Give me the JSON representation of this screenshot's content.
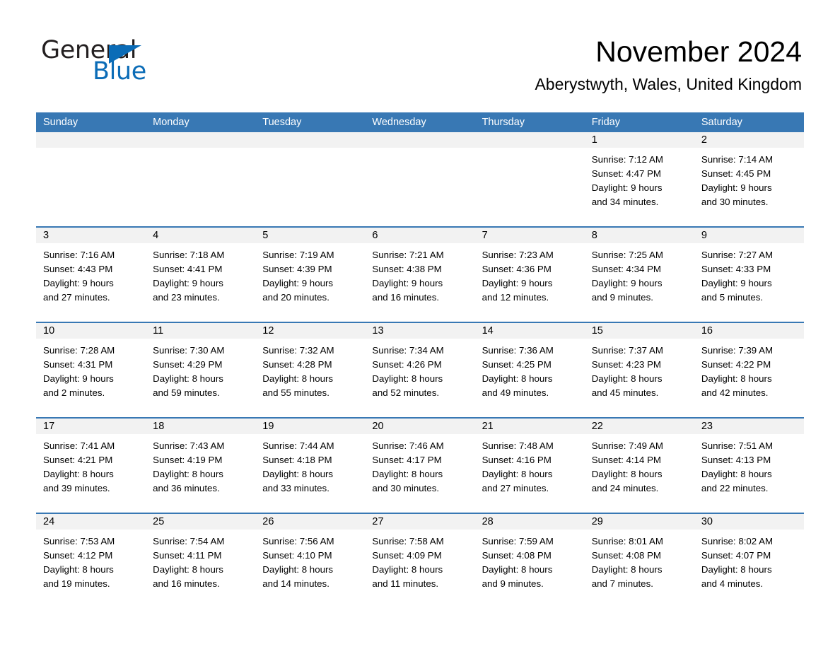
{
  "logo": {
    "word_one": "General",
    "word_two": "Blue",
    "triangle_color": "#0b6cb7"
  },
  "header": {
    "month_title": "November 2024",
    "location": "Aberystwyth, Wales, United Kingdom"
  },
  "colors": {
    "header_band": "#3878b4",
    "daynum_band": "#f2f2f2",
    "text": "#000000"
  },
  "weekday_headers": [
    "Sunday",
    "Monday",
    "Tuesday",
    "Wednesday",
    "Thursday",
    "Friday",
    "Saturday"
  ],
  "weeks": [
    [
      {
        "day": "",
        "sunrise": "",
        "sunset": "",
        "daylight_line1": "",
        "daylight_line2": ""
      },
      {
        "day": "",
        "sunrise": "",
        "sunset": "",
        "daylight_line1": "",
        "daylight_line2": ""
      },
      {
        "day": "",
        "sunrise": "",
        "sunset": "",
        "daylight_line1": "",
        "daylight_line2": ""
      },
      {
        "day": "",
        "sunrise": "",
        "sunset": "",
        "daylight_line1": "",
        "daylight_line2": ""
      },
      {
        "day": "",
        "sunrise": "",
        "sunset": "",
        "daylight_line1": "",
        "daylight_line2": ""
      },
      {
        "day": "1",
        "sunrise": "Sunrise: 7:12 AM",
        "sunset": "Sunset: 4:47 PM",
        "daylight_line1": "Daylight: 9 hours",
        "daylight_line2": "and 34 minutes."
      },
      {
        "day": "2",
        "sunrise": "Sunrise: 7:14 AM",
        "sunset": "Sunset: 4:45 PM",
        "daylight_line1": "Daylight: 9 hours",
        "daylight_line2": "and 30 minutes."
      }
    ],
    [
      {
        "day": "3",
        "sunrise": "Sunrise: 7:16 AM",
        "sunset": "Sunset: 4:43 PM",
        "daylight_line1": "Daylight: 9 hours",
        "daylight_line2": "and 27 minutes."
      },
      {
        "day": "4",
        "sunrise": "Sunrise: 7:18 AM",
        "sunset": "Sunset: 4:41 PM",
        "daylight_line1": "Daylight: 9 hours",
        "daylight_line2": "and 23 minutes."
      },
      {
        "day": "5",
        "sunrise": "Sunrise: 7:19 AM",
        "sunset": "Sunset: 4:39 PM",
        "daylight_line1": "Daylight: 9 hours",
        "daylight_line2": "and 20 minutes."
      },
      {
        "day": "6",
        "sunrise": "Sunrise: 7:21 AM",
        "sunset": "Sunset: 4:38 PM",
        "daylight_line1": "Daylight: 9 hours",
        "daylight_line2": "and 16 minutes."
      },
      {
        "day": "7",
        "sunrise": "Sunrise: 7:23 AM",
        "sunset": "Sunset: 4:36 PM",
        "daylight_line1": "Daylight: 9 hours",
        "daylight_line2": "and 12 minutes."
      },
      {
        "day": "8",
        "sunrise": "Sunrise: 7:25 AM",
        "sunset": "Sunset: 4:34 PM",
        "daylight_line1": "Daylight: 9 hours",
        "daylight_line2": "and 9 minutes."
      },
      {
        "day": "9",
        "sunrise": "Sunrise: 7:27 AM",
        "sunset": "Sunset: 4:33 PM",
        "daylight_line1": "Daylight: 9 hours",
        "daylight_line2": "and 5 minutes."
      }
    ],
    [
      {
        "day": "10",
        "sunrise": "Sunrise: 7:28 AM",
        "sunset": "Sunset: 4:31 PM",
        "daylight_line1": "Daylight: 9 hours",
        "daylight_line2": "and 2 minutes."
      },
      {
        "day": "11",
        "sunrise": "Sunrise: 7:30 AM",
        "sunset": "Sunset: 4:29 PM",
        "daylight_line1": "Daylight: 8 hours",
        "daylight_line2": "and 59 minutes."
      },
      {
        "day": "12",
        "sunrise": "Sunrise: 7:32 AM",
        "sunset": "Sunset: 4:28 PM",
        "daylight_line1": "Daylight: 8 hours",
        "daylight_line2": "and 55 minutes."
      },
      {
        "day": "13",
        "sunrise": "Sunrise: 7:34 AM",
        "sunset": "Sunset: 4:26 PM",
        "daylight_line1": "Daylight: 8 hours",
        "daylight_line2": "and 52 minutes."
      },
      {
        "day": "14",
        "sunrise": "Sunrise: 7:36 AM",
        "sunset": "Sunset: 4:25 PM",
        "daylight_line1": "Daylight: 8 hours",
        "daylight_line2": "and 49 minutes."
      },
      {
        "day": "15",
        "sunrise": "Sunrise: 7:37 AM",
        "sunset": "Sunset: 4:23 PM",
        "daylight_line1": "Daylight: 8 hours",
        "daylight_line2": "and 45 minutes."
      },
      {
        "day": "16",
        "sunrise": "Sunrise: 7:39 AM",
        "sunset": "Sunset: 4:22 PM",
        "daylight_line1": "Daylight: 8 hours",
        "daylight_line2": "and 42 minutes."
      }
    ],
    [
      {
        "day": "17",
        "sunrise": "Sunrise: 7:41 AM",
        "sunset": "Sunset: 4:21 PM",
        "daylight_line1": "Daylight: 8 hours",
        "daylight_line2": "and 39 minutes."
      },
      {
        "day": "18",
        "sunrise": "Sunrise: 7:43 AM",
        "sunset": "Sunset: 4:19 PM",
        "daylight_line1": "Daylight: 8 hours",
        "daylight_line2": "and 36 minutes."
      },
      {
        "day": "19",
        "sunrise": "Sunrise: 7:44 AM",
        "sunset": "Sunset: 4:18 PM",
        "daylight_line1": "Daylight: 8 hours",
        "daylight_line2": "and 33 minutes."
      },
      {
        "day": "20",
        "sunrise": "Sunrise: 7:46 AM",
        "sunset": "Sunset: 4:17 PM",
        "daylight_line1": "Daylight: 8 hours",
        "daylight_line2": "and 30 minutes."
      },
      {
        "day": "21",
        "sunrise": "Sunrise: 7:48 AM",
        "sunset": "Sunset: 4:16 PM",
        "daylight_line1": "Daylight: 8 hours",
        "daylight_line2": "and 27 minutes."
      },
      {
        "day": "22",
        "sunrise": "Sunrise: 7:49 AM",
        "sunset": "Sunset: 4:14 PM",
        "daylight_line1": "Daylight: 8 hours",
        "daylight_line2": "and 24 minutes."
      },
      {
        "day": "23",
        "sunrise": "Sunrise: 7:51 AM",
        "sunset": "Sunset: 4:13 PM",
        "daylight_line1": "Daylight: 8 hours",
        "daylight_line2": "and 22 minutes."
      }
    ],
    [
      {
        "day": "24",
        "sunrise": "Sunrise: 7:53 AM",
        "sunset": "Sunset: 4:12 PM",
        "daylight_line1": "Daylight: 8 hours",
        "daylight_line2": "and 19 minutes."
      },
      {
        "day": "25",
        "sunrise": "Sunrise: 7:54 AM",
        "sunset": "Sunset: 4:11 PM",
        "daylight_line1": "Daylight: 8 hours",
        "daylight_line2": "and 16 minutes."
      },
      {
        "day": "26",
        "sunrise": "Sunrise: 7:56 AM",
        "sunset": "Sunset: 4:10 PM",
        "daylight_line1": "Daylight: 8 hours",
        "daylight_line2": "and 14 minutes."
      },
      {
        "day": "27",
        "sunrise": "Sunrise: 7:58 AM",
        "sunset": "Sunset: 4:09 PM",
        "daylight_line1": "Daylight: 8 hours",
        "daylight_line2": "and 11 minutes."
      },
      {
        "day": "28",
        "sunrise": "Sunrise: 7:59 AM",
        "sunset": "Sunset: 4:08 PM",
        "daylight_line1": "Daylight: 8 hours",
        "daylight_line2": "and 9 minutes."
      },
      {
        "day": "29",
        "sunrise": "Sunrise: 8:01 AM",
        "sunset": "Sunset: 4:08 PM",
        "daylight_line1": "Daylight: 8 hours",
        "daylight_line2": "and 7 minutes."
      },
      {
        "day": "30",
        "sunrise": "Sunrise: 8:02 AM",
        "sunset": "Sunset: 4:07 PM",
        "daylight_line1": "Daylight: 8 hours",
        "daylight_line2": "and 4 minutes."
      }
    ]
  ]
}
